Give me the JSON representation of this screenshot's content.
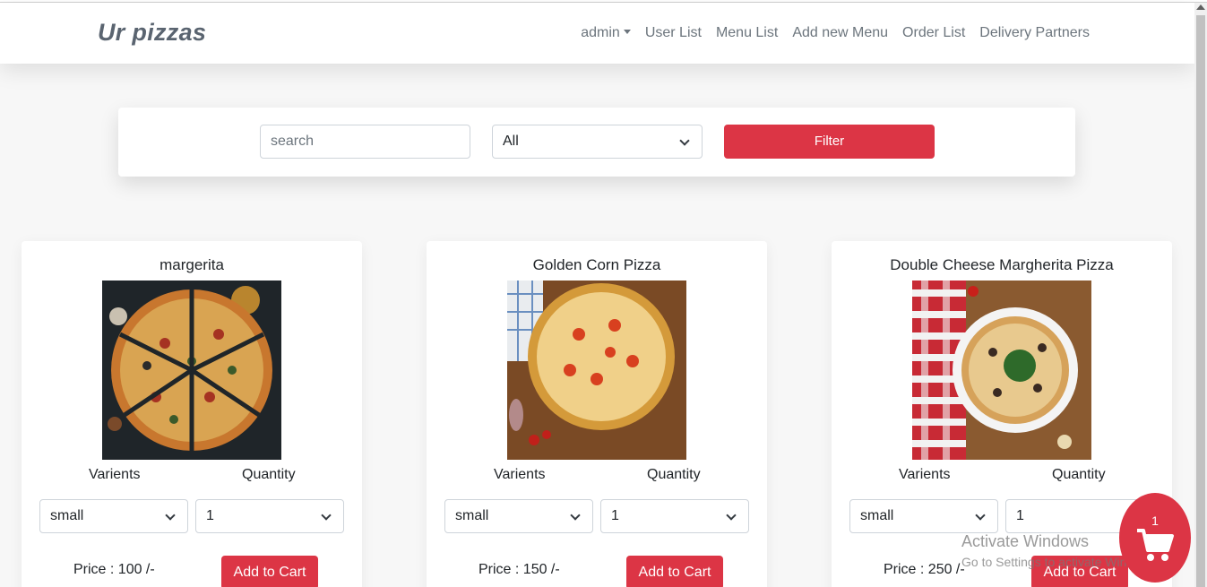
{
  "brand": "Ur pizzas",
  "nav": {
    "admin": "admin",
    "links": [
      "User List",
      "Menu List",
      "Add new Menu",
      "Order List",
      "Delivery Partners"
    ]
  },
  "filter": {
    "search_placeholder": "search",
    "category_selected": "All",
    "button_label": "Filter"
  },
  "cards": [
    {
      "name": "margerita",
      "varients_label": "Varients",
      "quantity_label": "Quantity",
      "variant": "small",
      "quantity": "1",
      "price": "Price : 100 /-",
      "button": "Add to Cart"
    },
    {
      "name": "Golden Corn Pizza",
      "varients_label": "Varients",
      "quantity_label": "Quantity",
      "variant": "small",
      "quantity": "1",
      "price": "Price : 150 /-",
      "button": "Add to Cart"
    },
    {
      "name": "Double Cheese Margherita Pizza",
      "varients_label": "Varients",
      "quantity_label": "Quantity",
      "variant": "small",
      "quantity": "1",
      "price": "Price : 250 /-",
      "button": "Add to Cart"
    }
  ],
  "cart": {
    "count": "1",
    "icon": "cart-icon"
  },
  "watermark": {
    "line1": "Activate Windows",
    "line2": "Go to Settings to activate Windows."
  },
  "colors": {
    "accent": "#dc3545",
    "brand": "#5a6470",
    "nav_text": "#6c757d"
  }
}
